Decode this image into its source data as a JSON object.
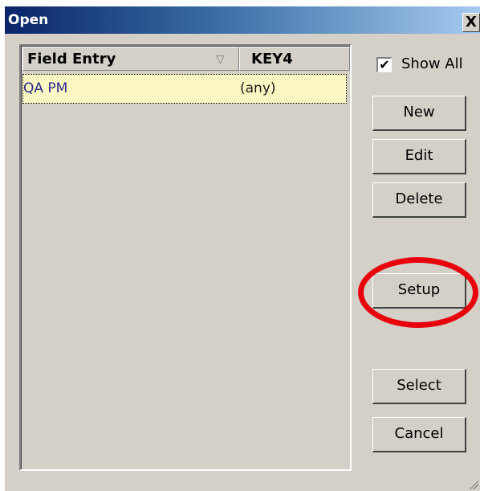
{
  "window": {
    "title": "Open",
    "close_label": "X"
  },
  "list": {
    "columns": [
      "Field Entry",
      "KEY4"
    ],
    "sort_icon": "▽",
    "rows": [
      {
        "name": "QA PM",
        "key": "(any)"
      }
    ]
  },
  "options": {
    "show_all_label": "Show All",
    "show_all_checked": true,
    "check_mark": "✔"
  },
  "buttons": {
    "new": "New",
    "edit": "Edit",
    "delete": "Delete",
    "setup": "Setup",
    "select": "Select",
    "cancel": "Cancel"
  },
  "annotation": {
    "color": "#e8000b"
  }
}
